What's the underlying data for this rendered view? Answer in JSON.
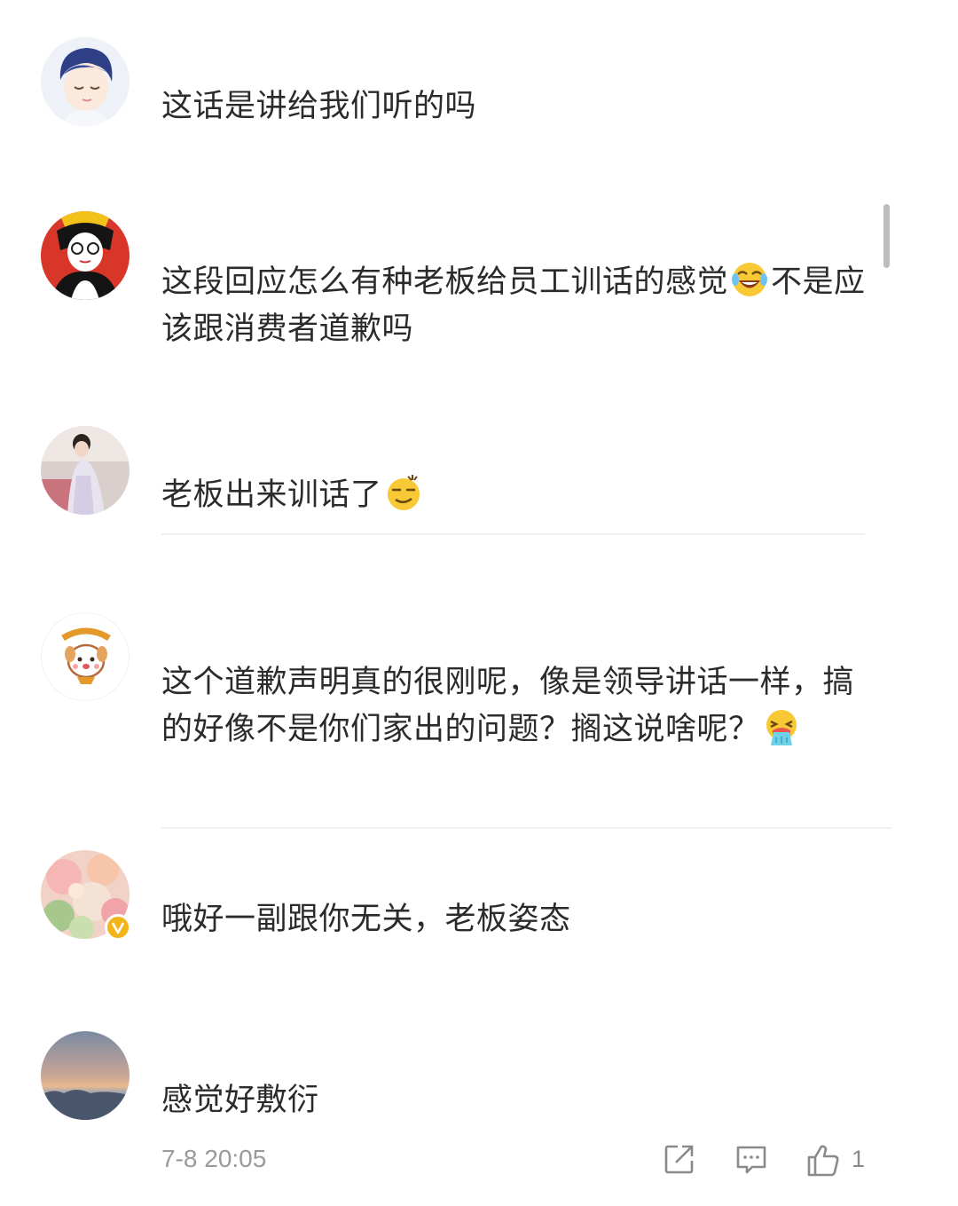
{
  "comments": [
    {
      "text_1": "这话是讲给我们听的吗"
    },
    {
      "text_1": "这段回应怎么有种老板给员工训话的感觉",
      "emoji_1": "laugh-cry-emoji",
      "text_2": "不是应该跟消费者道歉吗"
    },
    {
      "text_1": "老板出来训话了",
      "emoji_1": "smug-emoji"
    },
    {
      "text_1": "这个道歉声明真的很刚呢，像是领导讲话一样，搞的好像不是你们家出的问题？搁这说啥呢？",
      "emoji_1": "vomit-emoji"
    },
    {
      "text_1": "哦好一副跟你无关，老板姿态",
      "badge": "verified-badge-icon"
    },
    {
      "text_1": "感觉好敷衍"
    }
  ],
  "footer": {
    "timestamp": "7-8 20:05",
    "like_count": "1",
    "icons": [
      "share-icon",
      "comment-icon",
      "like-icon"
    ]
  },
  "colors": {
    "text": "#2b2b2b",
    "meta": "#9a9a9a",
    "divider": "#f0f0f0",
    "verified": "#f2b417"
  }
}
